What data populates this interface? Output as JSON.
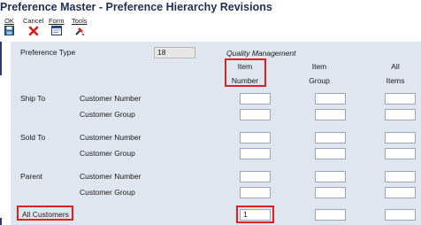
{
  "window": {
    "title": "Preference Master - Preference Hierarchy Revisions"
  },
  "toolbar": {
    "ok_label": "OK",
    "cancel_label": "Cancel",
    "form_label": "Form",
    "tools_label": "Tools"
  },
  "form": {
    "preference_type_label": "Preference Type",
    "preference_type_value": "18",
    "preference_type_desc": "Quality Management",
    "columns": [
      {
        "line1": "Item",
        "line2": "Number"
      },
      {
        "line1": "Item",
        "line2": "Group"
      },
      {
        "line1": "All",
        "line2": "Items"
      }
    ],
    "groups": [
      {
        "name": "Ship To",
        "rows": [
          "Customer Number",
          "Customer Group"
        ]
      },
      {
        "name": "Sold To",
        "rows": [
          "Customer Number",
          "Customer Group"
        ]
      },
      {
        "name": "Parent",
        "rows": [
          "Customer Number",
          "Customer Group"
        ]
      }
    ],
    "all_customers_label": "All Customers",
    "all_customers_item_number_value": "1"
  },
  "colors": {
    "highlight": "#e02020",
    "form_background": "#dfe6f0",
    "title": "#1f2f56"
  }
}
